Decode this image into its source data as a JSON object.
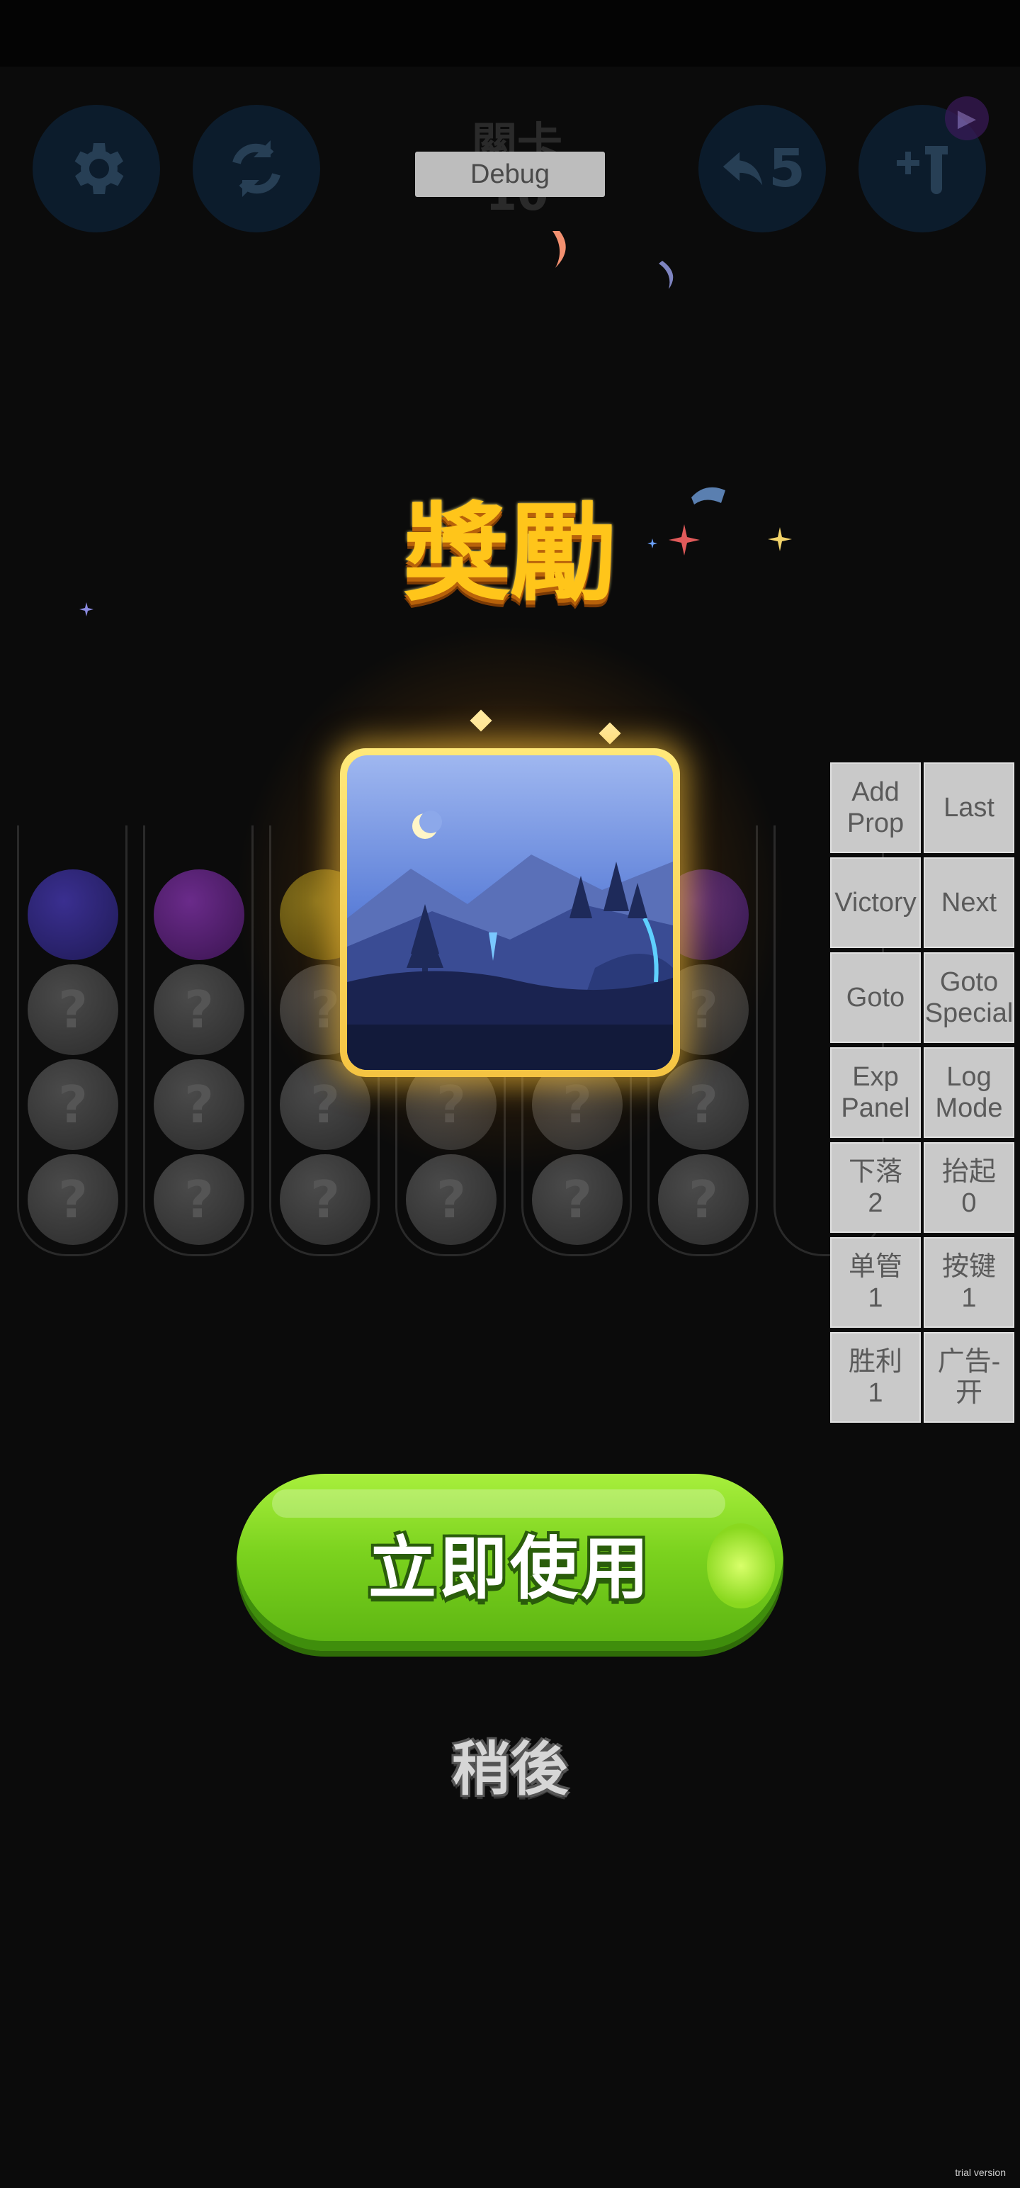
{
  "hud": {
    "level_label": "關卡\n10",
    "debug_label": "Debug",
    "undo_count": "5",
    "icons": [
      "gear-icon",
      "restart-icon",
      "undo-icon",
      "add-tube-icon",
      "ad-play-icon"
    ]
  },
  "reward": {
    "title": "獎勵",
    "image": "night-mountain-background"
  },
  "tubes": {
    "question_mark": "?"
  },
  "debug_panel": {
    "buttons": [
      "Add\nProp",
      "Last",
      "Victory",
      "Next",
      "Goto",
      "Goto\nSpecial",
      "Exp\nPanel",
      "Log\nMode",
      "下落\n2",
      "抬起\n0",
      "单管\n1",
      "按键\n1",
      "胜利\n1",
      "广告-开"
    ]
  },
  "actions": {
    "use_now": "立即使用",
    "later": "稍後"
  },
  "watermark": "trial version",
  "colors": {
    "title_gold": "#ffc51a",
    "button_green": "#7bd21e",
    "hud_blue": "#0d2a47"
  }
}
